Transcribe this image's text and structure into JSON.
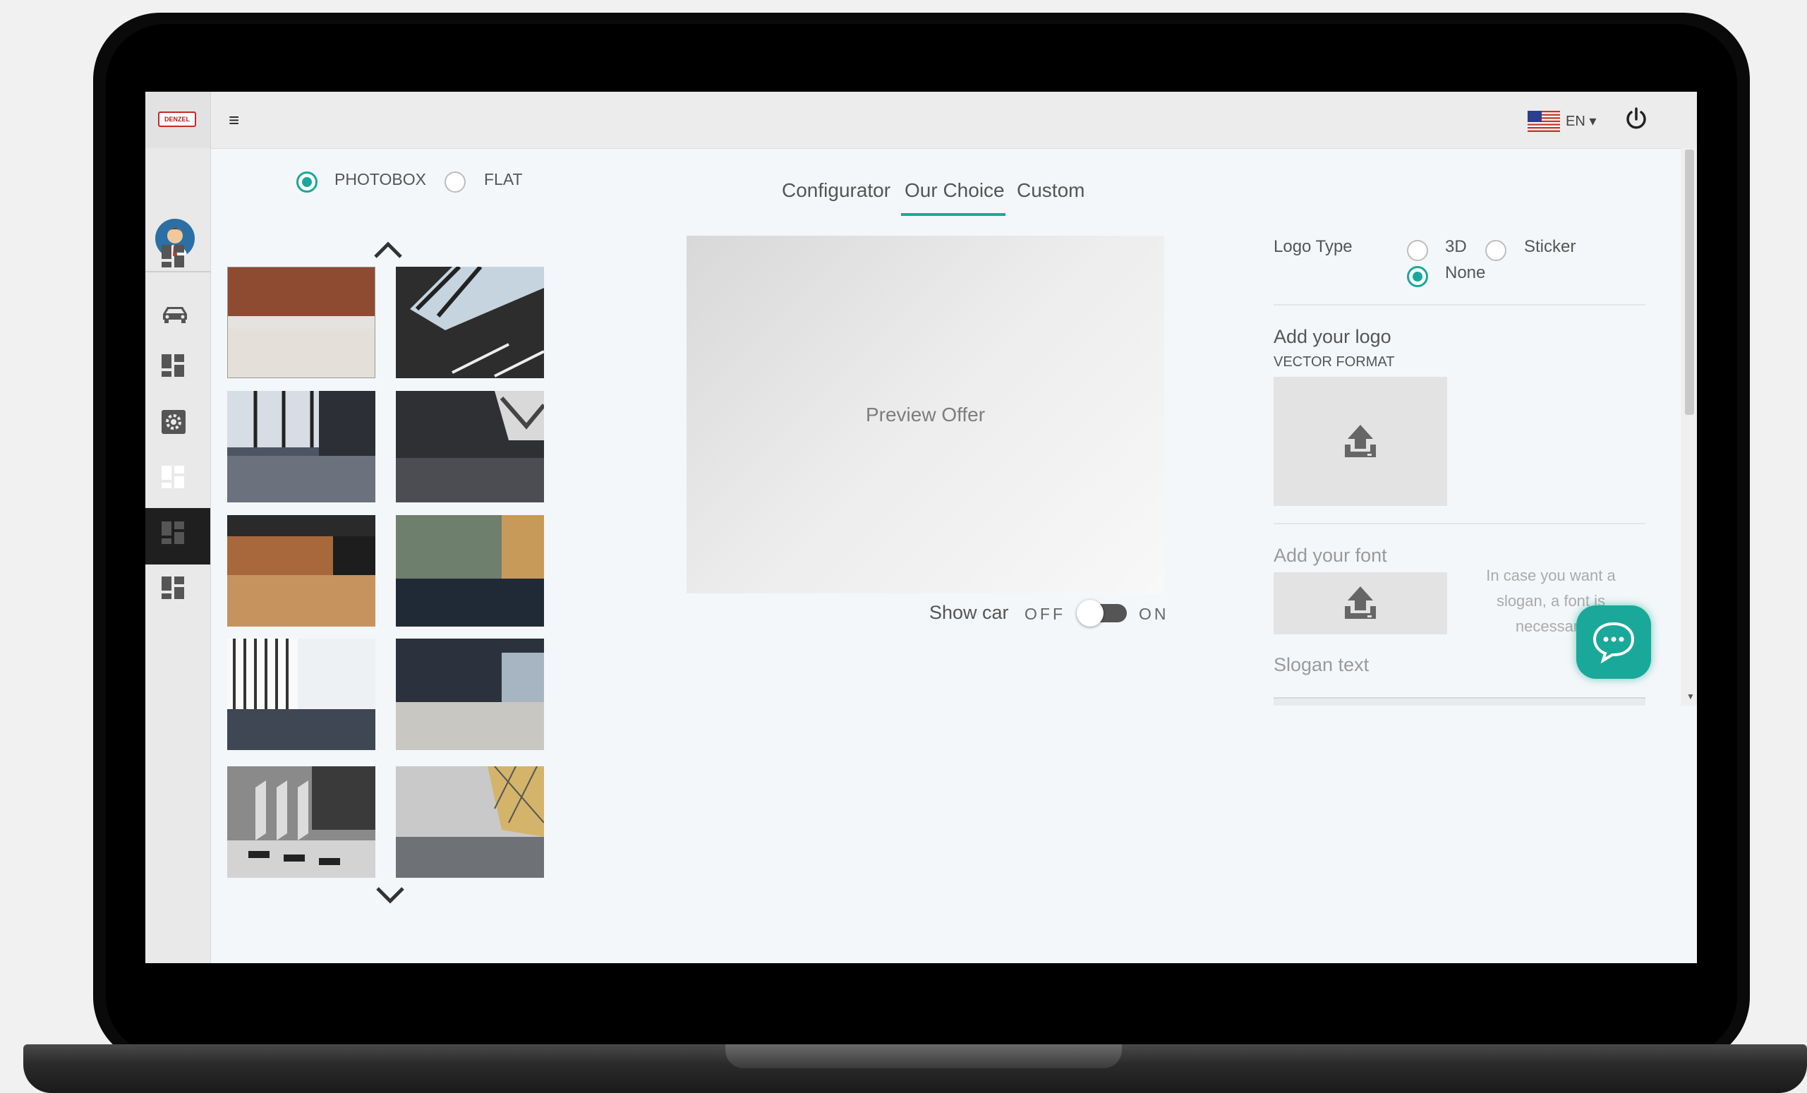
{
  "topbar": {
    "language": "EN",
    "logo_text": "DENZEL"
  },
  "photo_mode": {
    "options": [
      "PHOTOBOX",
      "FLAT"
    ],
    "selected": "PHOTOBOX"
  },
  "tabs": [
    {
      "label": "Configurator",
      "active": false
    },
    {
      "label": "Our Choice",
      "active": true
    },
    {
      "label": "Custom",
      "active": false
    }
  ],
  "preview": {
    "placeholder": "Preview Offer"
  },
  "show_car": {
    "label": "Show car",
    "off": "OFF",
    "on": "ON",
    "value": false
  },
  "logo_type": {
    "label": "Logo Type",
    "options": [
      "3D",
      "Sticker",
      "None"
    ],
    "selected": "None"
  },
  "add_logo": {
    "title": "Add your logo",
    "subtitle": "VECTOR FORMAT"
  },
  "add_font": {
    "title": "Add your font",
    "hint": "In case you want a slogan, a font is necessary"
  },
  "slogan": {
    "label": "Slogan text"
  },
  "colors": {
    "accent": "#1aa89a",
    "sidebar_active": "#1f1f1f"
  },
  "icons": [
    "menu-icon",
    "power-icon",
    "chat-icon",
    "upload-icon",
    "chevron-up-icon",
    "chevron-down-icon",
    "car-icon",
    "settings-icon",
    "dashboard-icon"
  ]
}
